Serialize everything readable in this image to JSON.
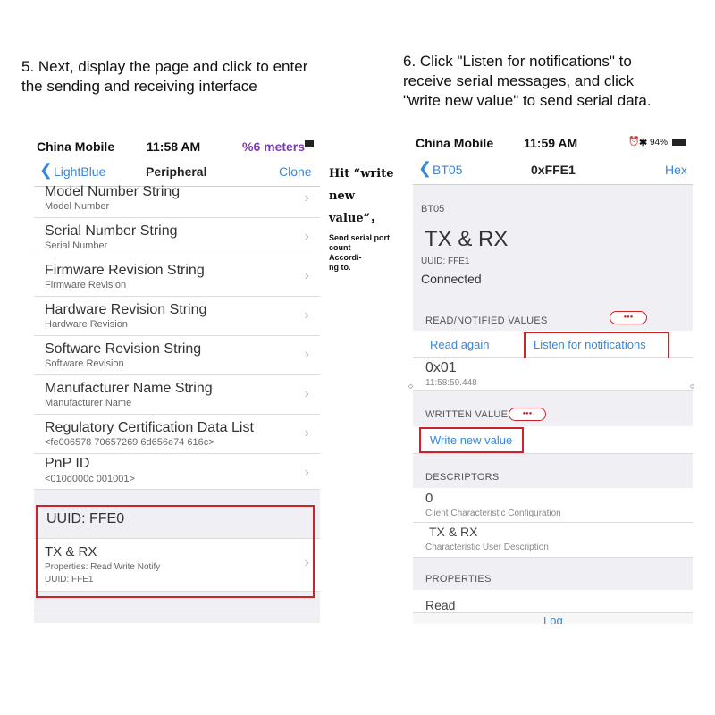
{
  "step5": {
    "line1": "5. Next, display the page and click to enter",
    "line2": "the sending and receiving interface"
  },
  "step6": {
    "line1": "6. Click \"Listen for notifications\" to",
    "line2": "receive serial messages, and click",
    "line3": "\"write new value\" to send serial data."
  },
  "note": {
    "hit_line1": "Hit “write",
    "hit_line2": "new",
    "hit_line3": "value”，",
    "small_line1": "Send serial port",
    "small_line2": "count",
    "small_line3": "Accordi-",
    "small_line4": "ng to."
  },
  "left_phone": {
    "status": {
      "carrier": "China Mobile",
      "time": "11:58 AM",
      "right": "%6 meters"
    },
    "nav": {
      "back": "LightBlue",
      "title": "Peripheral",
      "action": "Clone"
    },
    "rows": [
      {
        "title": "Model Number String",
        "subtitle": "Model Number"
      },
      {
        "title": "Serial Number String",
        "subtitle": "Serial Number"
      },
      {
        "title": "Firmware Revision String",
        "subtitle": "Firmware Revision"
      },
      {
        "title": "Hardware Revision String",
        "subtitle": "Hardware Revision"
      },
      {
        "title": "Software Revision String",
        "subtitle": "Software Revision"
      },
      {
        "title": "Manufacturer Name String",
        "subtitle": "Manufacturer Name"
      },
      {
        "title": "Regulatory Certification Data List",
        "subtitle": "<fe006578 70657269 6d656e74 616c>"
      },
      {
        "title": "PnP ID",
        "subtitle": "<010d000c 001001>"
      }
    ],
    "uuid_header": "UUID: FFE0",
    "char": {
      "title": "TX & RX",
      "props": "Properties: Read Write Notify",
      "uuid": "UUID: FFE1"
    }
  },
  "right_phone": {
    "status": {
      "carrier": "China Mobile",
      "time": "11:59 AM",
      "battery": "94%"
    },
    "nav": {
      "back": "BT05",
      "title": "0xFFE1",
      "action": "Hex"
    },
    "device": "BT05",
    "char_title": "TX & RX",
    "uuid": "UUID: FFE1",
    "connected": "Connected",
    "read_header": "READ/NOTIFIED VALUES",
    "read_again": "Read again",
    "listen": "Listen for notifications",
    "value": "0x01",
    "timestamp": "11:58:59.448",
    "written_header": "WRITTEN VALUES",
    "write_new": "Write new value",
    "descriptors_header": "DESCRIPTORS",
    "desc1_value": "0",
    "desc1_label": "Client Characteristic Configuration",
    "desc2_value": "TX & RX",
    "desc2_label": "Characteristic User Description",
    "properties_header": "PROPERTIES",
    "prop_partial": "Read",
    "log_partial": "Log"
  },
  "colors": {
    "accent": "#3a86d9",
    "highlight": "#cc2229"
  }
}
